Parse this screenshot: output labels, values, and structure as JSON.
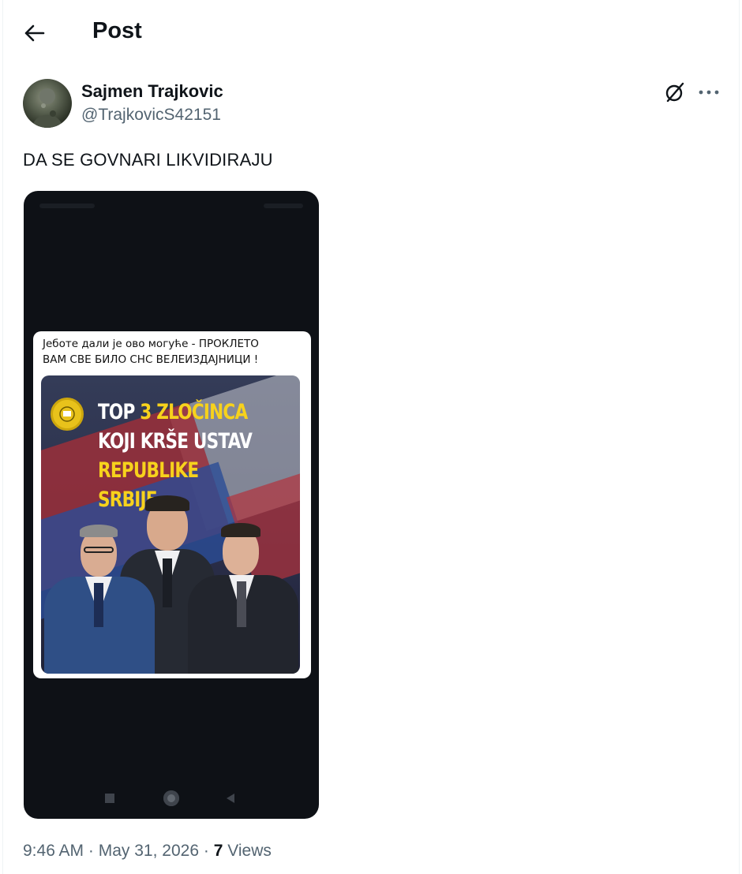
{
  "header": {
    "title": "Post",
    "back_icon": "arrow-left-icon"
  },
  "author": {
    "display_name": "Sajmen Trajkovic",
    "handle": "@TrajkovicS42151",
    "avatar_icon": "avatar"
  },
  "actions": {
    "grok_icon": "grok-icon",
    "more_icon": "more-horizontal-icon"
  },
  "post": {
    "text": "DA SE GOVNARI LIKVIDIRAJU",
    "media": {
      "caption_line1": "Јеботе дали је ово могуће - ПРОКЛЕТО",
      "caption_line2": "ВАМ СВЕ БИЛО СНС ВЕЛЕИЗДАЈНИЦИ !",
      "headline_top": "TOP",
      "headline_number": "3 ZLOČINCA",
      "headline_mid": "KOJI KRŠE USTAV",
      "headline_bottom": "REPUBLIKE SRBIJE"
    },
    "timestamp_time": "9:46 AM",
    "timestamp_date": "May 31, 2026",
    "views_count": "7",
    "views_label": "Views",
    "separator": "·"
  },
  "colors": {
    "text_primary": "#0f1419",
    "text_secondary": "#536471",
    "headline_yellow": "#f7d21c",
    "media_background": "#0e1116"
  }
}
